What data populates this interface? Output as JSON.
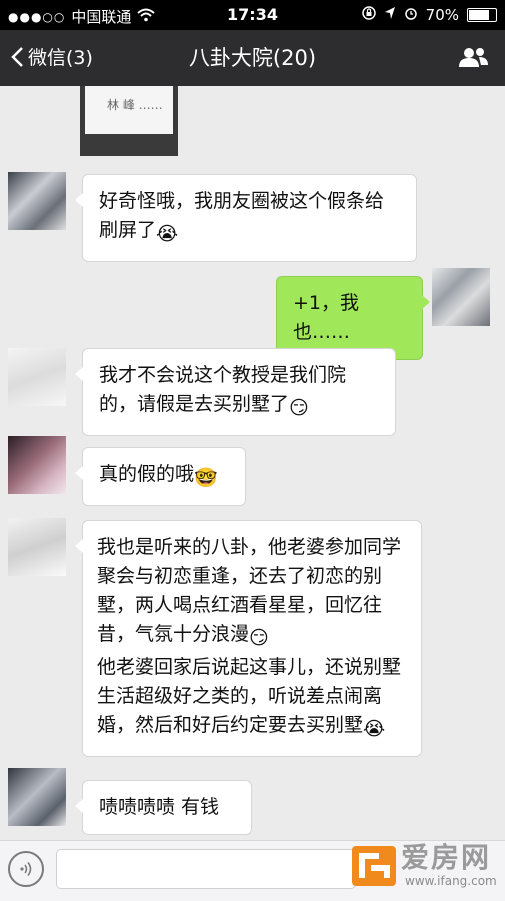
{
  "status_bar": {
    "carrier": "中国联通",
    "time": "17:34",
    "battery": "70%",
    "battery_level": 0.7
  },
  "nav": {
    "back_label": "微信(3)",
    "title": "八卦大院(20)",
    "group_icon": "group-members-icon"
  },
  "shared_image": {
    "scribble": "林 峰 ……"
  },
  "messages": [
    {
      "sender": "other",
      "text": "好奇怪哦，我朋友圈被这个假条给刷屏了",
      "emoji": "😭"
    },
    {
      "sender": "self",
      "text": "+1，我也……",
      "emoji": ""
    },
    {
      "sender": "other",
      "text": "我才不会说这个教授是我们院的，请假是去买别墅了",
      "emoji": "😏"
    },
    {
      "sender": "other",
      "text": "真的假的哦",
      "emoji": "🤓"
    },
    {
      "sender": "other",
      "text": "我也是听来的八卦，他老婆参加同学聚会与初恋重逢，还去了初恋的别墅，两人喝点红酒看星星，回忆往昔，气氛十分浪漫",
      "emoji": "😏",
      "text2": "他老婆回家后说起这事儿，还说别墅生活超级好之类的，听说差点闹离婚，然后和好后约定要去买别墅",
      "emoji2": "😭"
    },
    {
      "sender": "other",
      "text": "啧啧啧啧  有钱",
      "emoji": ""
    }
  ],
  "input_bar": {
    "voice_icon": "voice-icon"
  },
  "watermark": {
    "name": "爱房网",
    "url": "www.ifang.com"
  }
}
